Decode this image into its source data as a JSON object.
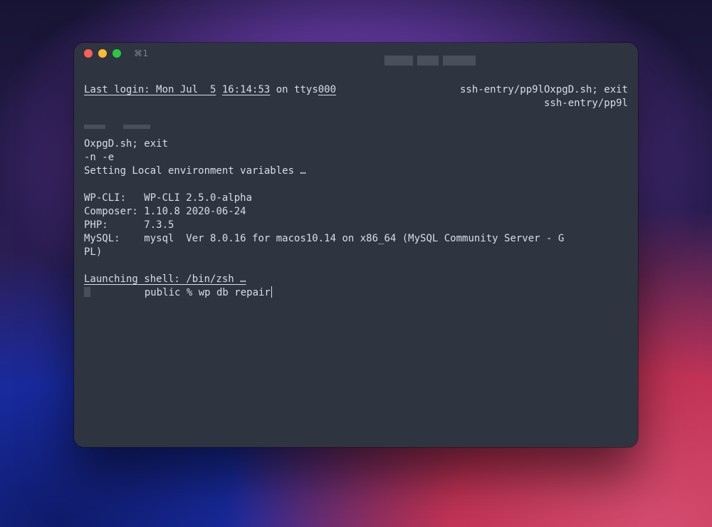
{
  "titlebar": {
    "tab_label_glyph": "⌘",
    "tab_label_text": "1"
  },
  "term": {
    "last_login_prefix": "Last login: Mon Jul  5",
    "last_login_time": "16:14:53",
    "last_login_on": " on ttys",
    "last_login_tty": "000",
    "ssh_line1": "ssh-entry/pp9lOxpgD.sh; exit",
    "ssh_line2": "ssh-entry/pp9l",
    "oxpg_line": "OxpgD.sh; exit",
    "ne_line": "-n -e",
    "setting_line": "Setting Local environment variables …",
    "wpcli_label": "WP-CLI:   ",
    "wpcli_value": "WP-CLI 2.5.0-alpha",
    "composer_label": "Composer: ",
    "composer_value": "1.10.8 2020-06-24",
    "php_label": "PHP:      ",
    "php_value": "7.3.5",
    "mysql_label": "MySQL:    ",
    "mysql_value": "mysql  Ver 8.0.16 for macos10.14 on x86_64 (MySQL Community Server - G",
    "mysql_wrap": "PL)",
    "launch_line": "Launching shell: /bin/zsh …",
    "prompt_left_pad": "         ",
    "prompt_label": "public % ",
    "prompt_cmd": "wp db repair"
  }
}
